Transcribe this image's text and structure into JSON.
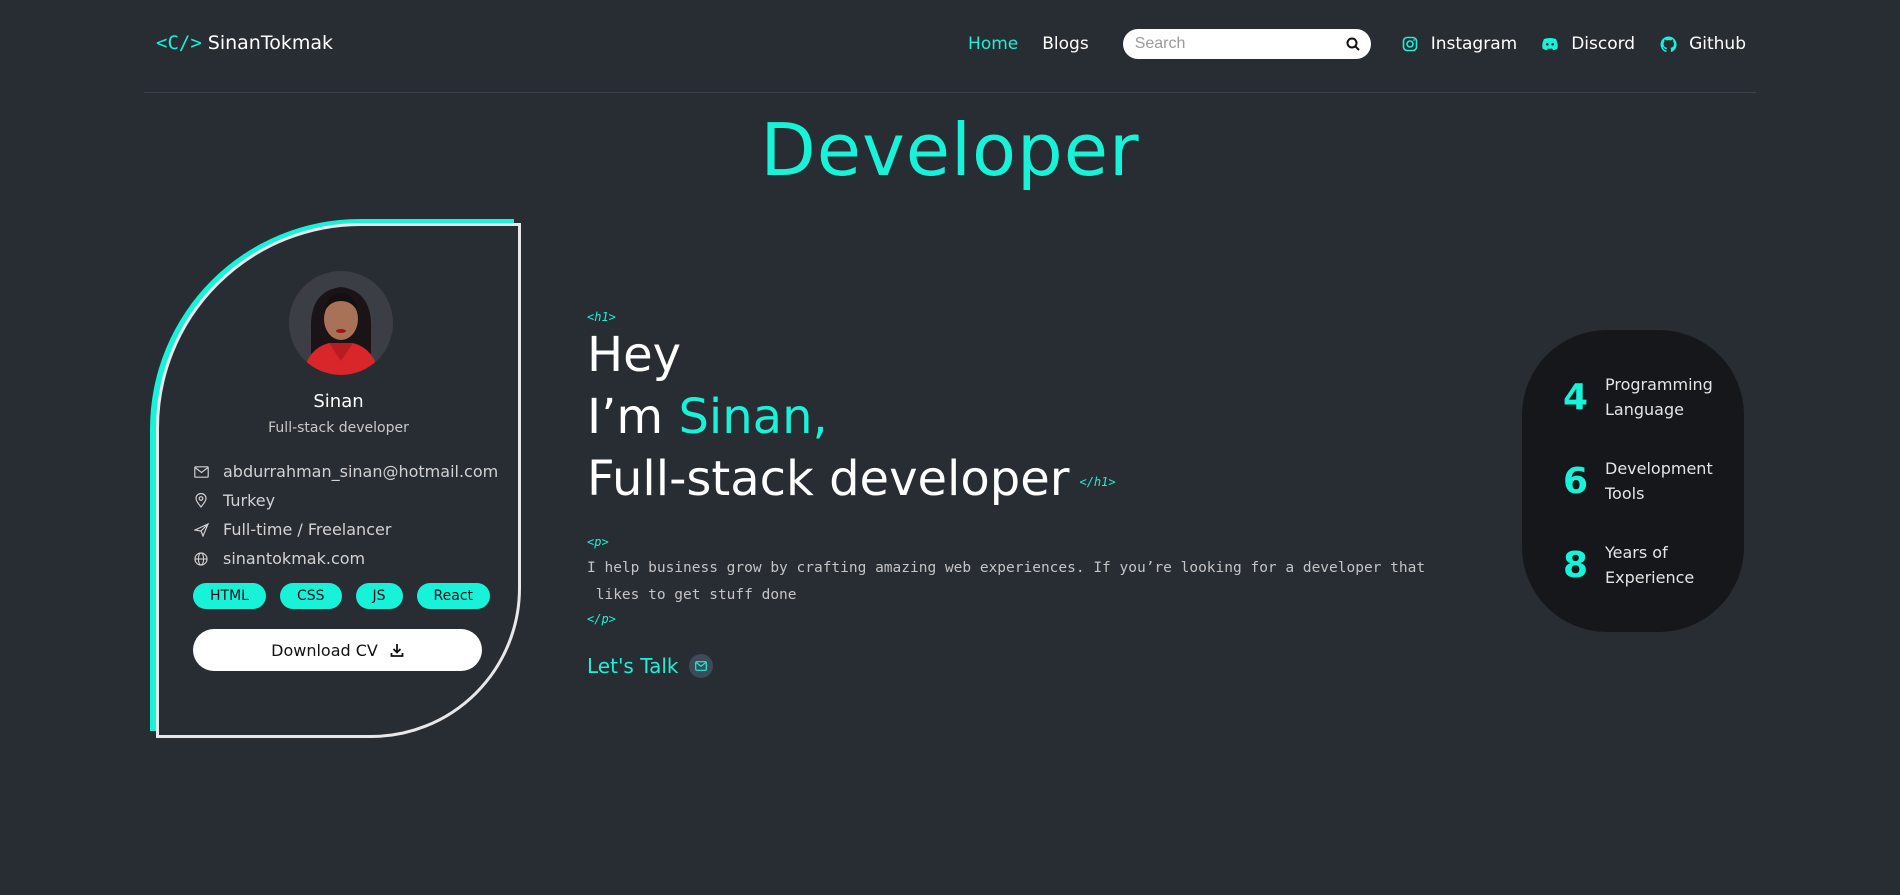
{
  "nav": {
    "logo_mark": "<C/>",
    "logo_text": "SinanTokmak",
    "links": [
      {
        "label": "Home",
        "active": true
      },
      {
        "label": "Blogs",
        "active": false
      }
    ],
    "search_placeholder": "Search",
    "socials": [
      {
        "label": "Instagram",
        "icon": "instagram-icon"
      },
      {
        "label": "Discord",
        "icon": "discord-icon"
      },
      {
        "label": "Github",
        "icon": "github-icon"
      }
    ]
  },
  "hero": {
    "title": "Developer"
  },
  "profile": {
    "name": "Sinan",
    "role": "Full-stack developer",
    "email": "abdurrahman_sinan@hotmail.com",
    "location": "Turkey",
    "employment": "Full-time / Freelancer",
    "website": "sinantokmak.com",
    "tags": [
      "HTML",
      "CSS",
      "JS",
      "React"
    ],
    "cv_button": "Download CV"
  },
  "intro": {
    "h1_open": "<h1>",
    "line1": "Hey",
    "line2_prefix": "I’m ",
    "line2_name": "Sinan,",
    "line3": "Full-stack developer",
    "h1_close": "</h1>",
    "p_open": "<p>",
    "paragraph_line1": "I help business grow by crafting amazing web experiences. If you’re looking for a developer that",
    "paragraph_line2": " likes to get stuff done",
    "p_close": "</p>",
    "cta": "Let's Talk"
  },
  "stats": [
    {
      "number": "4",
      "label_line1": "Programming",
      "label_line2": "Language"
    },
    {
      "number": "6",
      "label_line1": "Development",
      "label_line2": "Tools"
    },
    {
      "number": "8",
      "label_line1": "Years of",
      "label_line2": "Experience"
    }
  ],
  "colors": {
    "background": "#282c33",
    "accent": "#18f2d8",
    "stats_bg": "#15171a"
  }
}
